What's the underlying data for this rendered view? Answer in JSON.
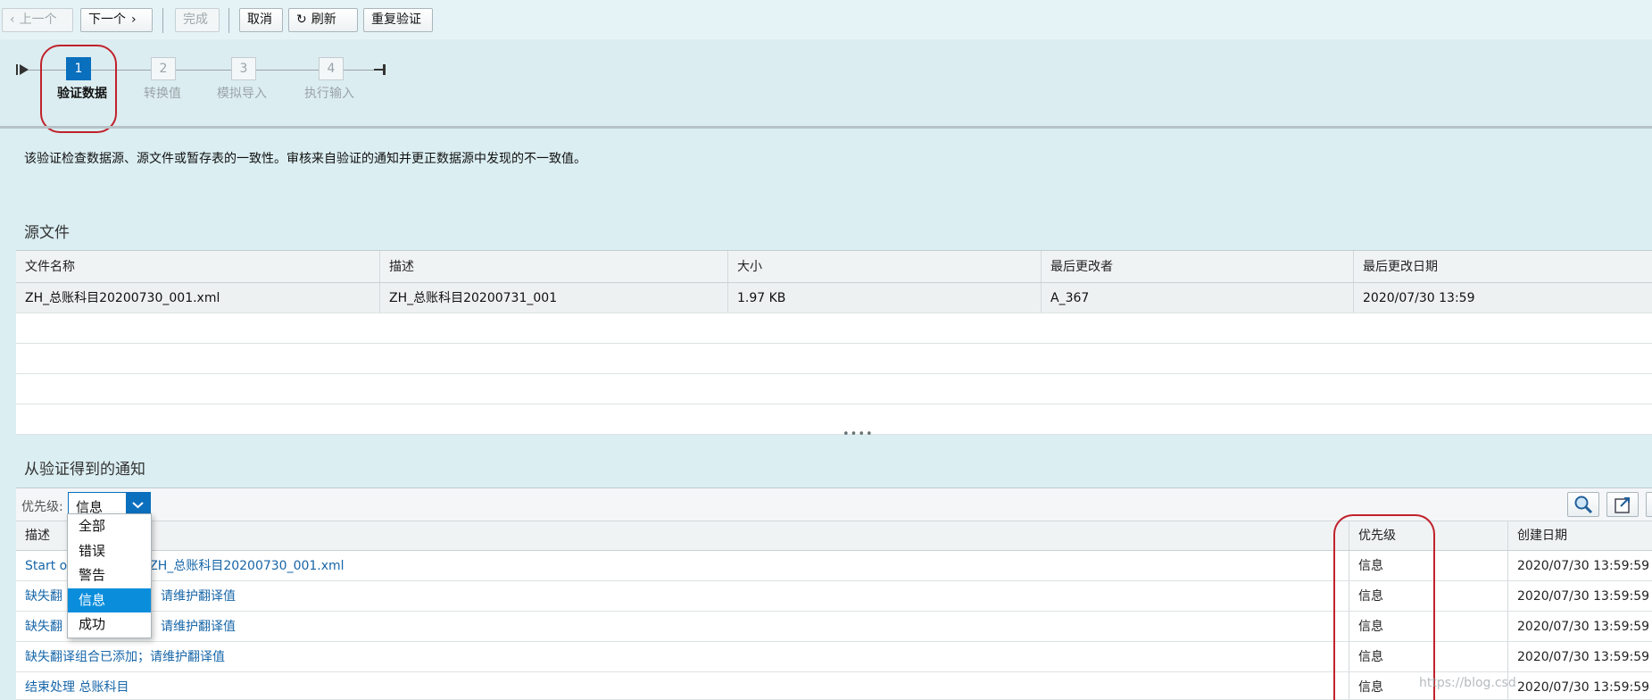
{
  "toolbar": {
    "prev_label": "上一个",
    "next_label": "下一个",
    "finish_label": "完成",
    "cancel_label": "取消",
    "refresh_label": "刷新",
    "revalidate_label": "重复验证"
  },
  "roadmap": {
    "steps": [
      {
        "number": "1",
        "label": "验证数据",
        "active": true
      },
      {
        "number": "2",
        "label": "转换值",
        "active": false
      },
      {
        "number": "3",
        "label": "模拟导入",
        "active": false
      },
      {
        "number": "4",
        "label": "执行输入",
        "active": false
      }
    ]
  },
  "intro_text": "该验证检查数据源、源文件或暂存表的一致性。审核来自验证的通知并更正数据源中发现的不一致值。",
  "source_files": {
    "title": "源文件",
    "columns": [
      "文件名称",
      "描述",
      "大小",
      "最后更改者",
      "最后更改日期"
    ],
    "rows": [
      [
        "ZH_总账科目20200730_001.xml",
        "ZH_总账科目20200731_001",
        "1.97 KB",
        "A_367",
        "2020/07/30 13:59"
      ]
    ]
  },
  "notifications": {
    "title": "从验证得到的通知",
    "priority_label": "优先级:",
    "priority_selected": "信息",
    "priority_options": [
      "全部",
      "错误",
      "警告",
      "信息",
      "成功"
    ],
    "columns": [
      "描述",
      "优先级",
      "创建日期"
    ],
    "rows": [
      {
        "desc": "Start of processing for file ZH_总账科目20200730_001.xml",
        "visible_desc": "Start o",
        "visible_desc_tail": "r file ZH_总账科目20200730_001.xml",
        "priority": "信息",
        "date": "2020/07/30 13:59:59"
      },
      {
        "desc": "缺失翻译组合已添加；请维护翻译值",
        "visible_desc": "缺失翻",
        "visible_desc_tail": "请维护翻译值",
        "priority": "信息",
        "date": "2020/07/30 13:59:59"
      },
      {
        "desc": "缺失翻译组合已添加；请维护翻译值",
        "visible_desc": "缺失翻",
        "visible_desc_tail": "请维护翻译值",
        "priority": "信息",
        "date": "2020/07/30 13:59:59"
      },
      {
        "desc": "缺失翻译组合已添加；请维护翻译值",
        "visible_desc": "缺失翻译组合已添加；请维护翻译值",
        "visible_desc_tail": "",
        "priority": "信息",
        "date": "2020/07/30 13:59:59"
      },
      {
        "desc": "结束处理 总账科目",
        "visible_desc": "结束处理 总账科目",
        "visible_desc_tail": "",
        "priority": "信息",
        "date": "2020/07/30 13:59:59"
      }
    ]
  },
  "watermark": "https://blog.csd",
  "colors": {
    "accent": "#0a6fbd",
    "highlight": "#c0222b",
    "link": "#1766a8"
  },
  "icons": [
    "chevron-left-icon",
    "chevron-right-icon",
    "refresh-icon",
    "roadmap-start-icon",
    "roadmap-end-icon",
    "chevron-down-icon",
    "search-icon",
    "export-icon"
  ]
}
